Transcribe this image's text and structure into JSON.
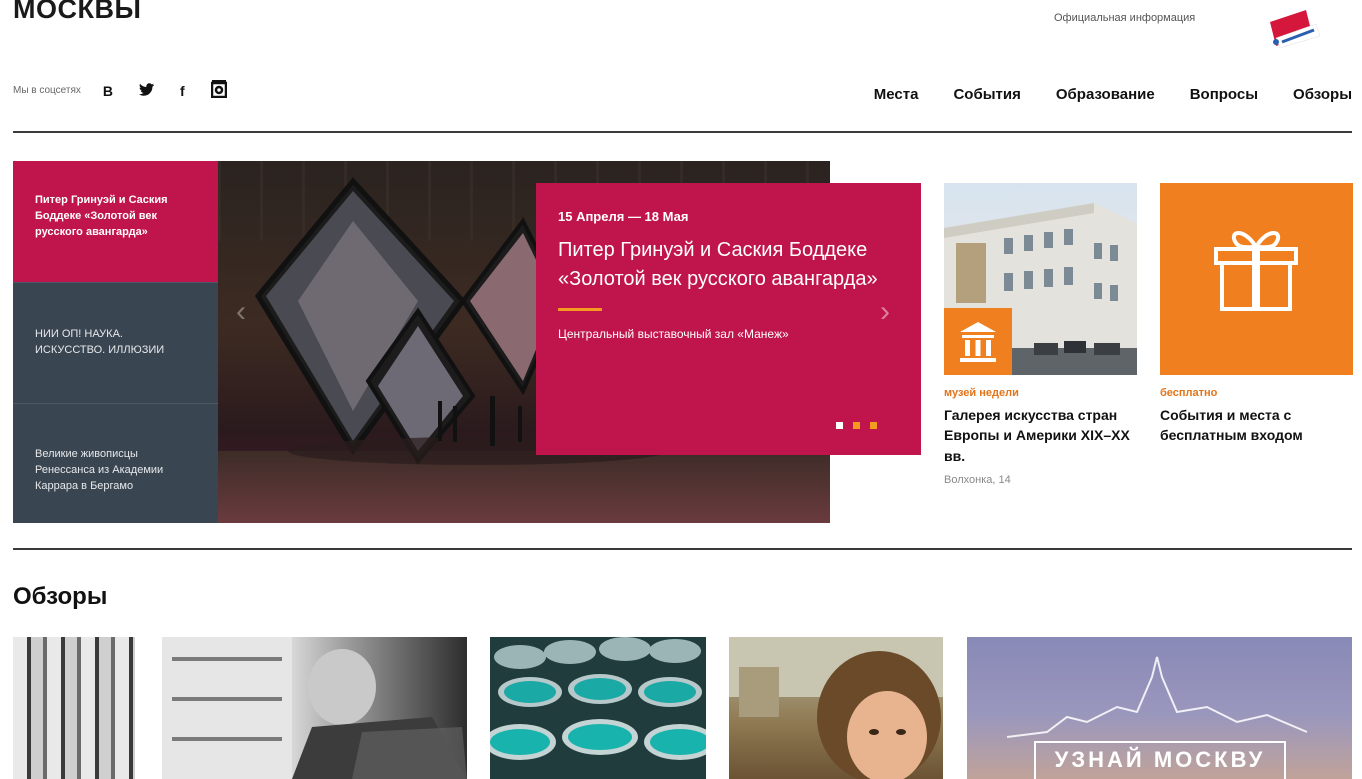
{
  "header": {
    "site_title": "МОСКВЫ",
    "official_info": "Официальная информация",
    "social_label": "Мы в соцсетях",
    "social_icons": [
      "vk-icon",
      "twitter-icon",
      "facebook-icon",
      "instagram-icon"
    ],
    "social_glyphs": {
      "vk": "B",
      "twitter": "🐦",
      "facebook": "f",
      "instagram": "◙"
    }
  },
  "nav": {
    "items": [
      "Места",
      "События",
      "Образование",
      "Вопросы",
      "Обзоры"
    ]
  },
  "carousel": {
    "side_items": [
      "Питер Гринуэй и Саския Боддеке «Золотой век русского авангарда»",
      "НИИ ОП! НАУКА. ИСКУССТВО. ИЛЛЮЗИИ",
      "Великие живописцы Ренессанса из Академии Каррара в Бергамо"
    ],
    "active_index": 0,
    "feature": {
      "dates": "15 Апреля — 18 Мая",
      "title": "Питер Гринуэй и Саския Боддеке «Золотой век русского авангарда»",
      "venue": "Центральный выставочный зал «Манеж»"
    },
    "dots_count": 3,
    "prev_arrow": "‹",
    "next_arrow": "›"
  },
  "cards": [
    {
      "tag": "музей недели",
      "title": "Галерея искусства стран Европы и Америки XIX–XX вв.",
      "address": "Волхонка, 14",
      "icon": "museum-icon"
    },
    {
      "tag": "бесплатно",
      "title": "События и места с бесплатным входом",
      "icon": "gift-icon"
    }
  ],
  "reviews": {
    "title": "Обзоры",
    "last_thumb_label": "УЗНАЙ МОСКВУ"
  },
  "colors": {
    "accent": "#c0144c",
    "orange": "#f0801f",
    "dark_panel": "#3a4552"
  }
}
